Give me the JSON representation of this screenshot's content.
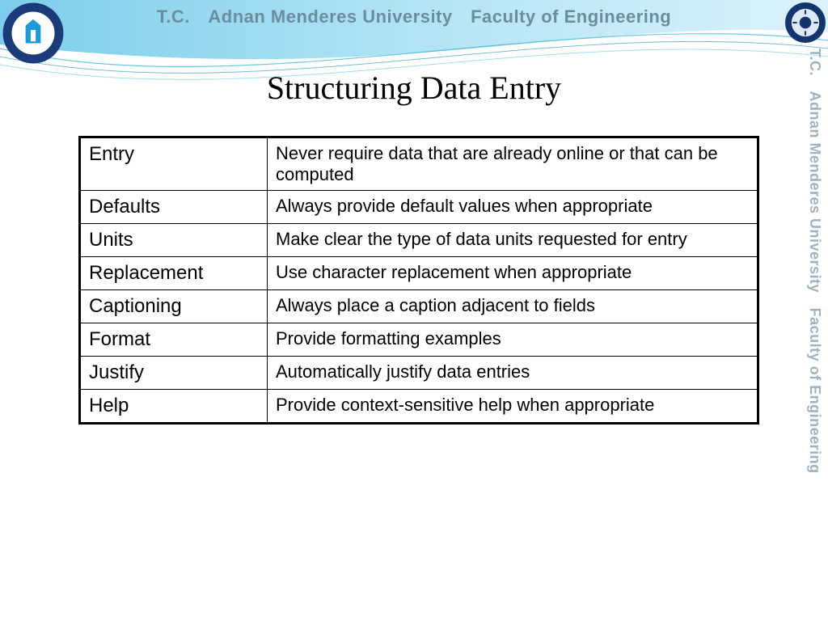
{
  "header": {
    "banner_text": "T.C. Adnan Menderes University Faculty of Engineering",
    "side_text": "T.C. Adnan Menderes University Faculty of Engineering"
  },
  "slide": {
    "title": "Structuring Data Entry"
  },
  "table": {
    "rows": [
      {
        "key": "Entry",
        "value": "Never require data that are already online or that can be computed"
      },
      {
        "key": "Defaults",
        "value": "Always provide default values when appropriate"
      },
      {
        "key": "Units",
        "value": "Make clear the type of data units requested for entry"
      },
      {
        "key": "Replacement",
        "value": "Use character replacement when appropriate"
      },
      {
        "key": "Captioning",
        "value": "Always place a caption adjacent to fields"
      },
      {
        "key": "Format",
        "value": "Provide formatting examples"
      },
      {
        "key": "Justify",
        "value": "Automatically justify data entries"
      },
      {
        "key": "Help",
        "value": "Provide context-sensitive help when appropriate"
      }
    ]
  }
}
